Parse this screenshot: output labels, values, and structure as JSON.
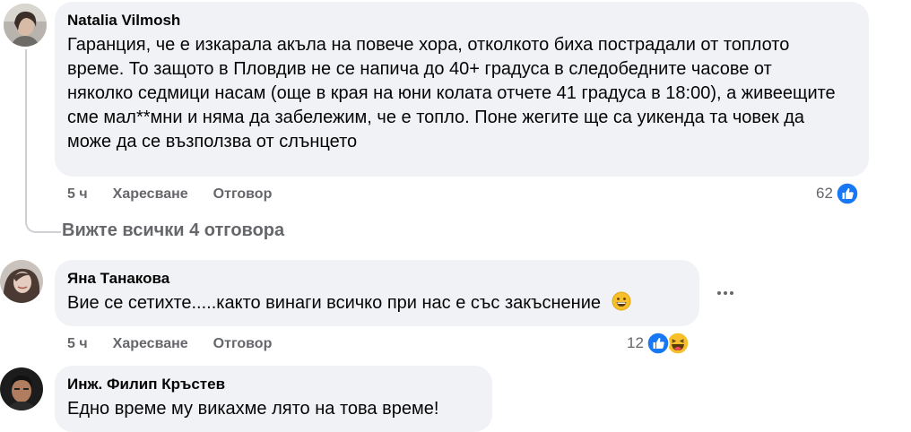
{
  "comments": [
    {
      "author": "Natalia Vilmosh",
      "text": "Гаранция, че е изкарала акъла на повече хора, отколкото биха пострадали от топлото време. То защото в Пловдив не се напича до 40+ градуса в следобедните часове от няколко седмици насам (още в края на юни колата отчете 41 градуса в 18:00), а живеещите сме мал**мни и няма да забележим, че е топло. Поне жегите ще са уикенда та човек да може да се възползва от слънцето",
      "time": "5 ч",
      "like_label": "Харесване",
      "reply_label": "Отговор",
      "reaction_count": "62",
      "reactions": [
        "like-icon"
      ]
    },
    {
      "author": "Яна Танакова",
      "text": "Вие се сетихте.....както винаги всичко при нас е със закъснение",
      "time": "5 ч",
      "like_label": "Харесване",
      "reply_label": "Отговор",
      "reaction_count": "12",
      "reactions": [
        "like-icon",
        "haha-icon"
      ]
    },
    {
      "author": "Инж. Филип Кръстев",
      "text": "Едно време му викахме лято на това време!"
    }
  ],
  "view_replies_label": "Вижте всички 4 отговора",
  "colors": {
    "bubble": "#f0f2f5",
    "secondary_text": "#65676b",
    "like_blue": "#1877f2",
    "thread_line": "#ced0d4"
  }
}
